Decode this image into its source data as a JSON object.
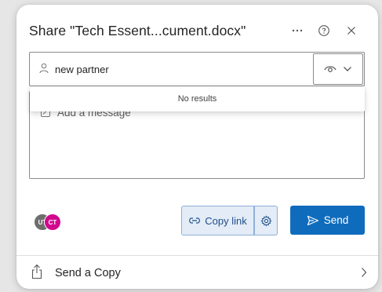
{
  "dialog": {
    "title": "Share \"Tech Essent...cument.docx\"",
    "more_icon": "more-horizontal-icon",
    "help_icon": "help-circle-icon",
    "close_icon": "close-icon"
  },
  "people_picker": {
    "value": "new partner",
    "person_icon": "person-icon",
    "permission_icon": "eye-icon",
    "permission_chevron": "chevron-down-icon"
  },
  "message": {
    "placeholder": "Add a message",
    "icon": "edit-note-icon"
  },
  "suggestions": {
    "text": "No results"
  },
  "avatars": [
    {
      "initials": "UT",
      "color": "#6e6e6e"
    },
    {
      "initials": "CT",
      "color": "#d1098e"
    }
  ],
  "actions": {
    "copy_link_label": "Copy link",
    "copy_link_icon": "link-icon",
    "link_settings_icon": "gear-icon",
    "send_label": "Send",
    "send_icon": "send-icon",
    "accent_color": "#0f6cbd"
  },
  "footer": {
    "send_copy_label": "Send a Copy",
    "send_copy_icon": "share-icon",
    "chevron_icon": "chevron-right-icon"
  }
}
